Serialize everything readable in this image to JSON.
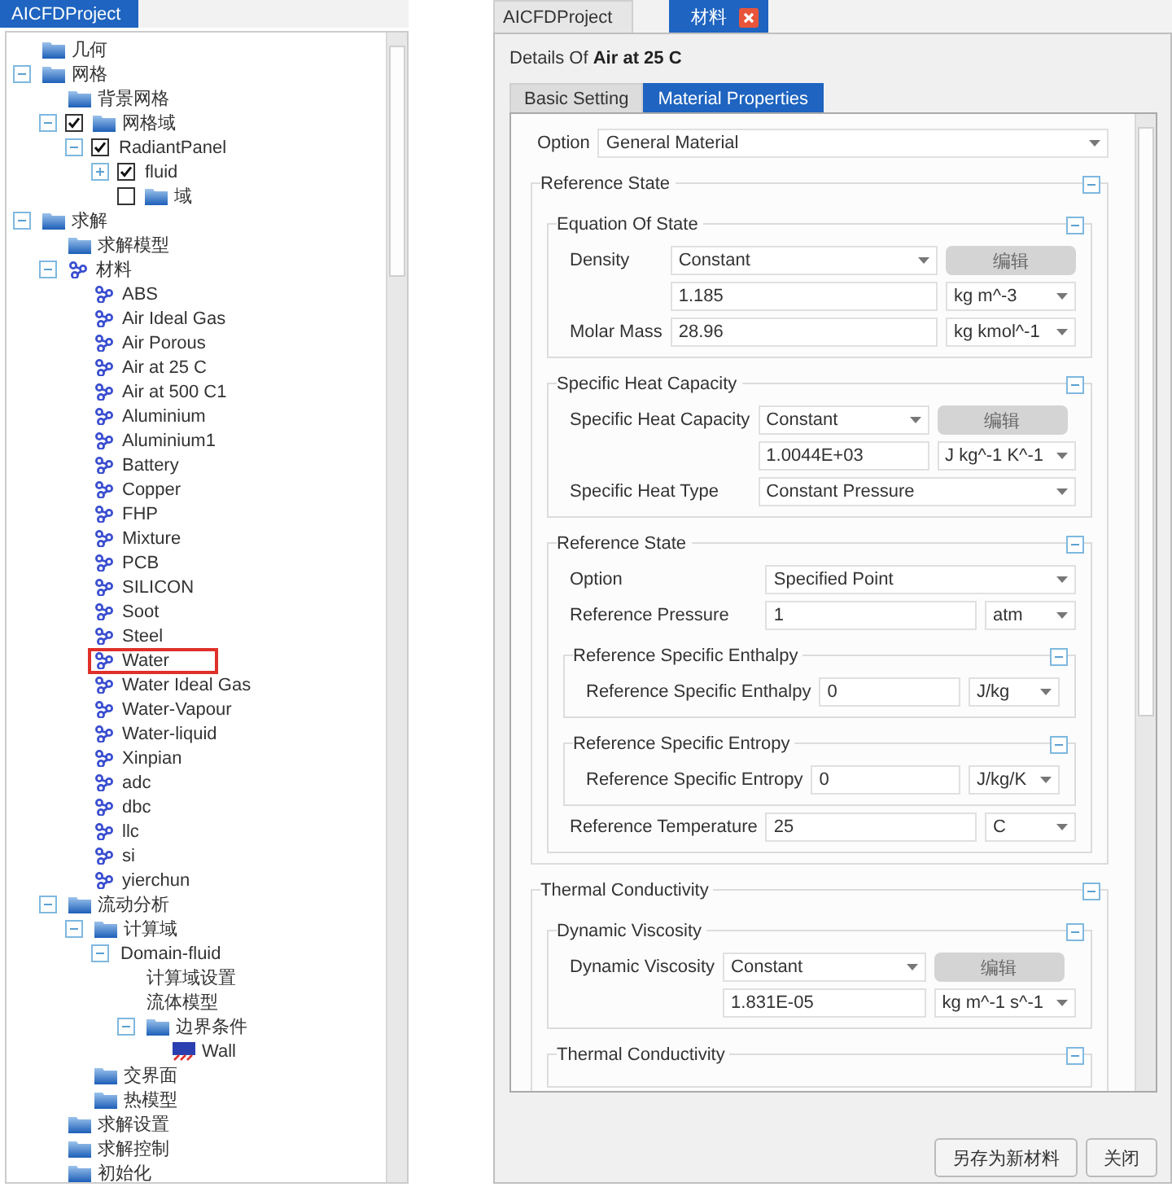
{
  "left_tabs": [
    {
      "label": "AICFDProject",
      "selected": true
    }
  ],
  "tree": [
    {
      "label": "几何",
      "kind": "folder"
    },
    {
      "label": "网格",
      "kind": "folder",
      "expanded": true,
      "children": [
        {
          "label": "背景网格",
          "kind": "folder"
        },
        {
          "label": "网格域",
          "kind": "folder",
          "expanded": true,
          "checked": true,
          "children": [
            {
              "label": "RadiantPanel",
              "kind": "plain",
              "expanded": true,
              "checked": true,
              "children": [
                {
                  "label": "fluid",
                  "kind": "plain",
                  "expanded": false,
                  "checked": true
                },
                {
                  "label": "域",
                  "kind": "folder",
                  "checked": false
                }
              ]
            }
          ]
        }
      ]
    },
    {
      "label": "求解",
      "kind": "folder",
      "expanded": true,
      "children": [
        {
          "label": "求解模型",
          "kind": "folder"
        },
        {
          "label": "材料",
          "kind": "material",
          "expanded": true,
          "children": [
            {
              "label": "ABS",
              "kind": "material",
              "highlighted": false
            },
            {
              "label": "Air Ideal Gas",
              "kind": "material",
              "highlighted": false
            },
            {
              "label": "Air Porous",
              "kind": "material",
              "highlighted": false
            },
            {
              "label": "Air at 25 C",
              "kind": "material",
              "highlighted": false
            },
            {
              "label": "Air at 500 C1",
              "kind": "material",
              "highlighted": false
            },
            {
              "label": "Aluminium",
              "kind": "material",
              "highlighted": false
            },
            {
              "label": "Aluminium1",
              "kind": "material",
              "highlighted": false
            },
            {
              "label": "Battery",
              "kind": "material",
              "highlighted": false
            },
            {
              "label": "Copper",
              "kind": "material",
              "highlighted": false
            },
            {
              "label": "FHP",
              "kind": "material",
              "highlighted": false
            },
            {
              "label": "Mixture",
              "kind": "material",
              "highlighted": false
            },
            {
              "label": "PCB",
              "kind": "material",
              "highlighted": false
            },
            {
              "label": "SILICON",
              "kind": "material",
              "highlighted": false
            },
            {
              "label": "Soot",
              "kind": "material",
              "highlighted": false
            },
            {
              "label": "Steel",
              "kind": "material",
              "highlighted": false
            },
            {
              "label": "Water",
              "kind": "material",
              "highlighted": true
            },
            {
              "label": "Water Ideal Gas",
              "kind": "material",
              "highlighted": false
            },
            {
              "label": "Water-Vapour",
              "kind": "material",
              "highlighted": false
            },
            {
              "label": "Water-liquid",
              "kind": "material",
              "highlighted": false
            },
            {
              "label": "Xinpian",
              "kind": "material",
              "highlighted": false
            },
            {
              "label": "adc",
              "kind": "material",
              "highlighted": false
            },
            {
              "label": "dbc",
              "kind": "material",
              "highlighted": false
            },
            {
              "label": "llc",
              "kind": "material",
              "highlighted": false
            },
            {
              "label": "si",
              "kind": "material",
              "highlighted": false
            },
            {
              "label": "yierchun",
              "kind": "material",
              "highlighted": false
            }
          ]
        },
        {
          "label": "流动分析",
          "kind": "folder",
          "expanded": true,
          "children": [
            {
              "label": "计算域",
              "kind": "folder",
              "expanded": true,
              "children": [
                {
                  "label": "Domain-fluid",
                  "kind": "plain",
                  "expanded": true,
                  "children": [
                    {
                      "label": "计算域设置",
                      "kind": "plain"
                    },
                    {
                      "label": "流体模型",
                      "kind": "plain"
                    },
                    {
                      "label": "边界条件",
                      "kind": "folder",
                      "expanded": true,
                      "children": [
                        {
                          "label": "Wall",
                          "kind": "wall"
                        }
                      ]
                    }
                  ]
                }
              ]
            },
            {
              "label": "交界面",
              "kind": "folder"
            },
            {
              "label": "热模型",
              "kind": "folder"
            }
          ]
        },
        {
          "label": "求解设置",
          "kind": "folder"
        },
        {
          "label": "求解控制",
          "kind": "folder"
        },
        {
          "label": "初始化",
          "kind": "folder"
        }
      ]
    }
  ],
  "right_tabs": [
    {
      "label": "AICFDProject",
      "selected": false,
      "closable": false
    },
    {
      "label": "材料",
      "selected": true,
      "closable": true
    }
  ],
  "details_title": "Details Of **Air at 25 C**",
  "form_tabs": [
    {
      "label": "Basic Setting",
      "selected": false
    },
    {
      "label": "Material Properties",
      "selected": true
    }
  ],
  "form": [
    {
      "kind": "row",
      "label": "Option",
      "control": {
        "kind": "select",
        "value": "General Material"
      }
    },
    {
      "kind": "group",
      "title": "Reference State",
      "expanded": true,
      "items": [
        {
          "kind": "group",
          "title": "Equation Of State",
          "expanded": true,
          "items": [
            {
              "kind": "row",
              "label": "Density",
              "control": {
                "kind": "select",
                "value": "Constant"
              },
              "side": {
                "kind": "button",
                "value": "编辑"
              }
            },
            {
              "kind": "row",
              "control": {
                "kind": "input",
                "value": "1.185"
              },
              "side": {
                "kind": "select",
                "value": "kg m^-3"
              }
            },
            {
              "kind": "row",
              "label": "Molar Mass",
              "control": {
                "kind": "input",
                "value": "28.96"
              },
              "side": {
                "kind": "select",
                "value": "kg kmol^-1"
              }
            }
          ]
        },
        {
          "kind": "group",
          "title": "Specific Heat Capacity",
          "expanded": true,
          "items": [
            {
              "kind": "row",
              "label": "Specific Heat Capacity",
              "control": {
                "kind": "select",
                "value": "Constant"
              },
              "side": {
                "kind": "button",
                "value": "编辑"
              }
            },
            {
              "kind": "row",
              "control": {
                "kind": "input",
                "value": "1.0044E+03"
              },
              "side": {
                "kind": "select",
                "value": "J kg^-1 K^-1"
              }
            },
            {
              "kind": "row",
              "label": "Specific Heat Type",
              "control": {
                "kind": "select",
                "value": "Constant Pressure"
              }
            }
          ]
        },
        {
          "kind": "group",
          "title": "Reference State",
          "expanded": true,
          "items": [
            {
              "kind": "row",
              "label": "Option",
              "control": {
                "kind": "select",
                "value": "Specified Point"
              }
            },
            {
              "kind": "row",
              "label": "Reference Pressure",
              "control": {
                "kind": "input",
                "value": "1"
              },
              "side": {
                "kind": "select",
                "value": "atm"
              }
            },
            {
              "kind": "group",
              "title": "Reference Specific Enthalpy",
              "expanded": true,
              "items": [
                {
                  "kind": "row",
                  "label": "Reference Specific Enthalpy",
                  "control": {
                    "kind": "input",
                    "value": "0"
                  },
                  "side": {
                    "kind": "select",
                    "value": "J/kg"
                  }
                }
              ]
            },
            {
              "kind": "group",
              "title": "Reference Specific Entropy",
              "expanded": true,
              "items": [
                {
                  "kind": "row",
                  "label": "Reference Specific Entropy",
                  "control": {
                    "kind": "input",
                    "value": "0"
                  },
                  "side": {
                    "kind": "select",
                    "value": "J/kg/K"
                  }
                }
              ]
            },
            {
              "kind": "row",
              "label": "Reference Temperature",
              "control": {
                "kind": "input",
                "value": "25"
              },
              "side": {
                "kind": "select",
                "value": "C"
              }
            }
          ]
        }
      ]
    },
    {
      "kind": "group",
      "title": "Thermal Conductivity",
      "expanded": true,
      "items": [
        {
          "kind": "group",
          "title": "Dynamic Viscosity",
          "expanded": true,
          "items": [
            {
              "kind": "row",
              "label": "Dynamic Viscosity",
              "control": {
                "kind": "select",
                "value": "Constant"
              },
              "side": {
                "kind": "button",
                "value": "编辑"
              }
            },
            {
              "kind": "row",
              "control": {
                "kind": "input",
                "value": "1.831E-05"
              },
              "side": {
                "kind": "select",
                "value": "kg m^-1 s^-1"
              }
            }
          ]
        },
        {
          "kind": "group",
          "title": "Thermal Conductivity",
          "expanded": true
        }
      ]
    }
  ],
  "buttons": [
    "另存为新材料",
    "关闭"
  ]
}
